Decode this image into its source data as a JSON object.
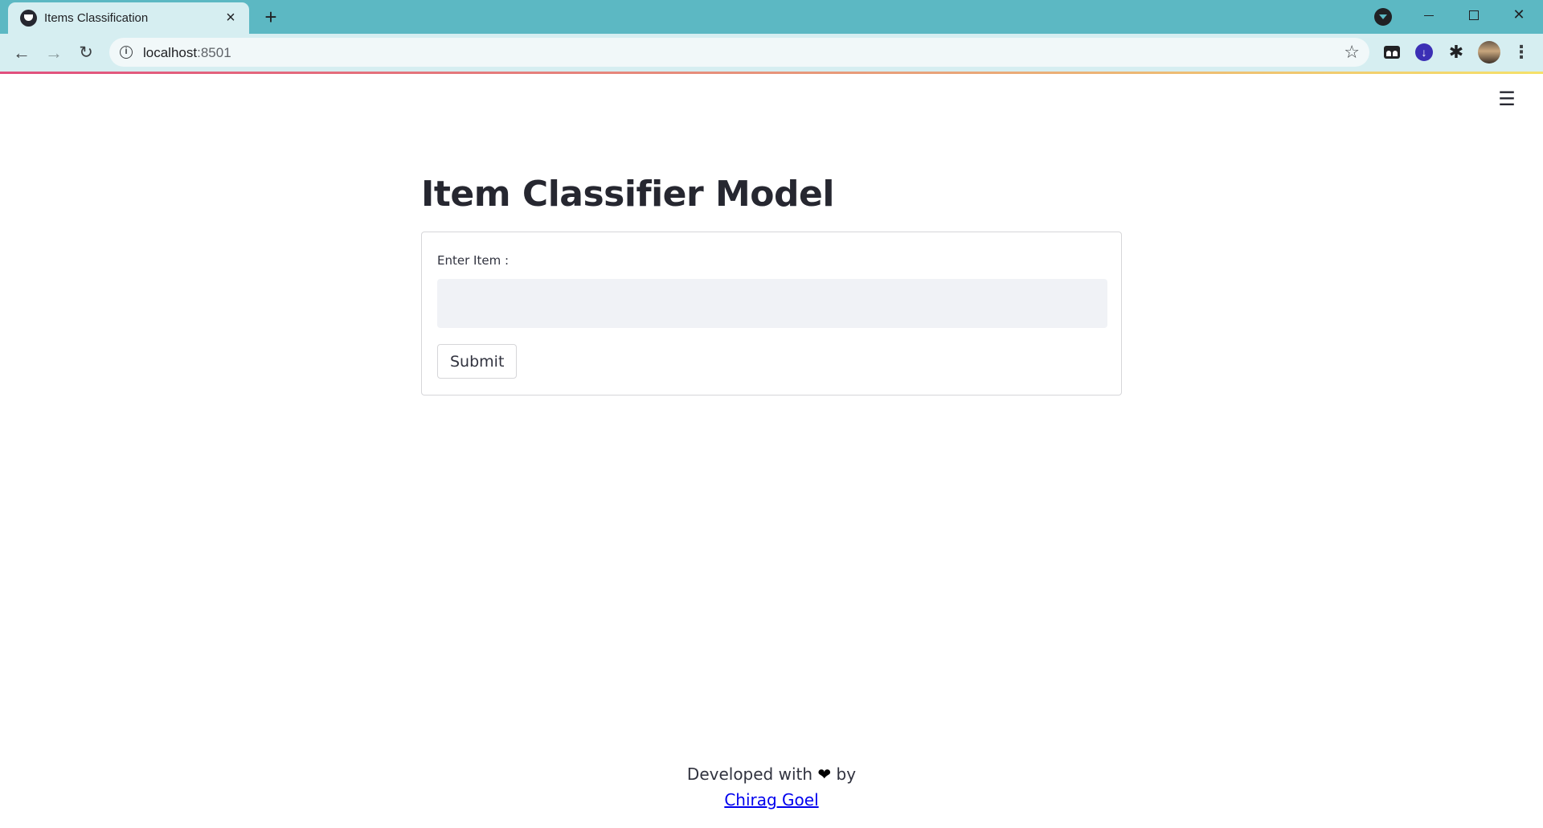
{
  "browser": {
    "tab": {
      "title": "Items Classification",
      "close_icon": "close-icon"
    },
    "new_tab_glyph": "+",
    "address": {
      "host": "localhost",
      "port": ":8501"
    },
    "colors": {
      "tabstrip": "#5cb8c3",
      "toolbar": "#d6eef1"
    }
  },
  "page": {
    "title": "Item Classifier Model",
    "form": {
      "field_label": "Enter Item :",
      "input_value": "",
      "submit_label": "Submit"
    },
    "footer": {
      "line1_prefix": "Developed with",
      "heart_glyph": "❤",
      "line1_suffix": "by",
      "author_link": "Chirag Goel"
    },
    "colors": {
      "text": "#262730",
      "input_bg": "#f0f2f6",
      "link": "#0000ee"
    }
  }
}
